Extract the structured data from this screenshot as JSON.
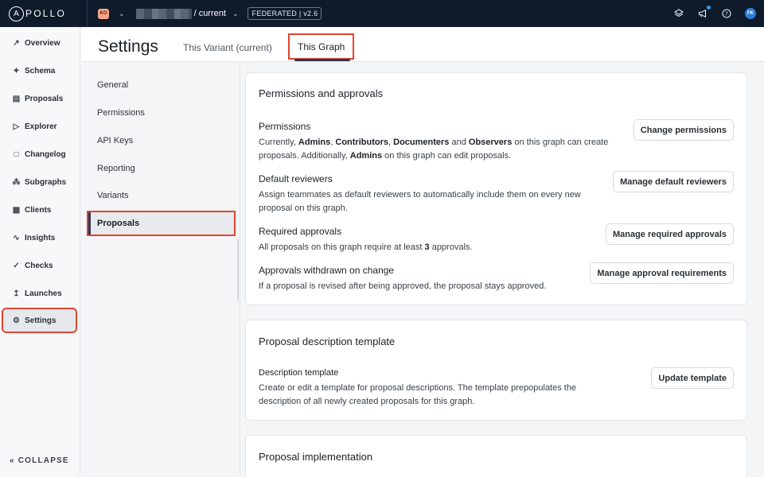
{
  "topbar": {
    "logo_mark": "A",
    "logo_text": "POLLO",
    "org_badge": "KO",
    "variant_label": "/ current",
    "federation_badge": "FEDERATED | v2.6",
    "avatar_initials": "FK",
    "notification_dot_color": "#2f9ce8"
  },
  "leftnav": {
    "items": [
      {
        "label": "Overview",
        "icon": "overview-icon"
      },
      {
        "label": "Schema",
        "icon": "schema-icon"
      },
      {
        "label": "Proposals",
        "icon": "proposals-icon"
      },
      {
        "label": "Explorer",
        "icon": "explorer-icon"
      },
      {
        "label": "Changelog",
        "icon": "changelog-icon"
      },
      {
        "label": "Subgraphs",
        "icon": "subgraphs-icon"
      },
      {
        "label": "Clients",
        "icon": "clients-icon"
      },
      {
        "label": "Insights",
        "icon": "insights-icon"
      },
      {
        "label": "Checks",
        "icon": "checks-icon"
      },
      {
        "label": "Launches",
        "icon": "launches-icon"
      },
      {
        "label": "Settings",
        "icon": "gear-icon",
        "active": true
      }
    ],
    "collapse_label": "COLLAPSE"
  },
  "header": {
    "title": "Settings",
    "tabs": [
      {
        "label": "This Variant (current)"
      },
      {
        "label": "This Graph",
        "active": true
      }
    ]
  },
  "subnav": {
    "items": [
      {
        "label": "General"
      },
      {
        "label": "Permissions"
      },
      {
        "label": "API Keys"
      },
      {
        "label": "Reporting"
      },
      {
        "label": "Variants"
      },
      {
        "label": "Proposals",
        "active": true
      }
    ]
  },
  "cards": {
    "permissions": {
      "title": "Permissions and approvals",
      "rows": {
        "permissions": {
          "title": "Permissions",
          "desc_parts": [
            "Currently, ",
            "Admins",
            ", ",
            "Contributors",
            ", ",
            "Documenters",
            " and ",
            "Observers",
            " on this graph can create proposals. Additionally, ",
            "Admins",
            " on this graph can edit proposals."
          ],
          "button": "Change permissions"
        },
        "reviewers": {
          "title": "Default reviewers",
          "desc": "Assign teammates as default reviewers to automatically include them on every new proposal on this graph.",
          "button": "Manage default reviewers"
        },
        "required": {
          "title": "Required approvals",
          "desc_parts": [
            "All proposals on this graph require at least ",
            "3",
            " approvals."
          ],
          "button": "Manage required approvals"
        },
        "withdrawn": {
          "title": "Approvals withdrawn on change",
          "desc": "If a proposal is revised after being approved, the proposal stays approved.",
          "button": "Manage approval requirements"
        }
      }
    },
    "template": {
      "title": "Proposal description template",
      "row_title": "Description template",
      "desc": "Create or edit a template for proposal descriptions. The template prepopulates the description of all newly created proposals for this graph.",
      "button": "Update template"
    },
    "implementation": {
      "title": "Proposal implementation"
    }
  },
  "colors": {
    "topbar_bg": "#0f1a2b",
    "highlight_outline": "#e2452f",
    "active_indicator": "#2b3a55"
  }
}
